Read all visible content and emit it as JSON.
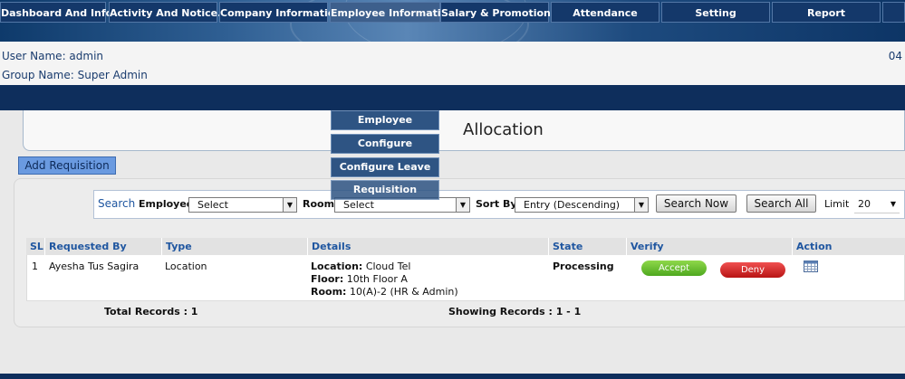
{
  "header": {
    "user_line": "User Name: admin",
    "group_line": "Group Name: Super Admin",
    "date_fragment": "04"
  },
  "nav": {
    "items": [
      "Dashboard And Info.",
      "Activity And Notice.",
      "Company Information",
      "Employee Information",
      "Salary & Promotion",
      "Attendance",
      "Setting",
      "Report"
    ],
    "dropdown": [
      "Employee",
      "Configure Weekend",
      "Configure Leave",
      "Requisition"
    ]
  },
  "page": {
    "title": "Allocation",
    "add_button": "Add Requisition"
  },
  "search": {
    "label": "Search",
    "employee_label": "Employee",
    "employee_value": "Select",
    "room_label": "Room",
    "room_value": "Select",
    "sort_label": "Sort By",
    "sort_value": "Entry (Descending)",
    "search_now": "Search Now",
    "search_all": "Search All",
    "limit_label": "Limit",
    "limit_value": "20"
  },
  "table": {
    "headers": [
      "SL",
      "Requested By",
      "Type",
      "Details",
      "State",
      "Verify",
      "Action"
    ],
    "rows": [
      {
        "sl": "1",
        "requested_by": "Ayesha Tus Sagira",
        "type": "Location",
        "details": [
          {
            "label": "Location:",
            "value": " Cloud Tel"
          },
          {
            "label": "Floor:",
            "value": " 10th Floor A"
          },
          {
            "label": "Room:",
            "value": " 10(A)-2 (HR & Admin)"
          }
        ],
        "state": "Processing",
        "accept": "Accept",
        "deny": "Deny"
      }
    ]
  },
  "footer": {
    "total": "Total Records : 1",
    "showing": "Showing Records : 1 - 1"
  },
  "colors": {
    "nav_bg": "#0e2e5c",
    "header_link": "#1f56a0",
    "accept": "#5fbf2a",
    "deny": "#d42020"
  }
}
